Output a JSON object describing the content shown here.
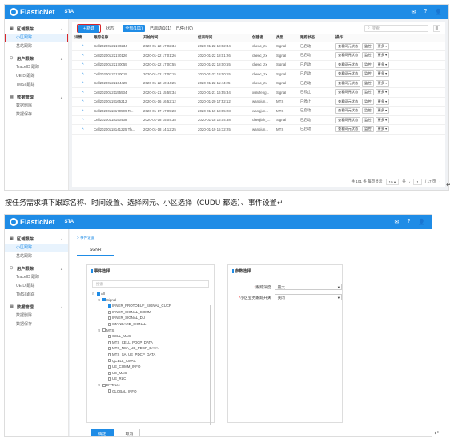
{
  "app": {
    "name": "ElasticNet",
    "product": "STA",
    "top_icons": [
      "mail-icon",
      "help-icon",
      "user-icon"
    ]
  },
  "sidebar": {
    "groups": [
      {
        "label": "区域跟踪",
        "icon": "area-icon",
        "items": [
          {
            "label": "小区跟踪",
            "active": true
          },
          {
            "label": "基站跟踪"
          }
        ]
      },
      {
        "label": "用户跟踪",
        "icon": "user-icon",
        "items": [
          {
            "label": "TraceID 跟踪"
          },
          {
            "label": "UEID 跟踪"
          },
          {
            "label": "TMSI 跟踪"
          }
        ]
      },
      {
        "label": "数据管理",
        "icon": "data-icon",
        "items": [
          {
            "label": "数据删除"
          },
          {
            "label": "数据保存"
          }
        ]
      }
    ]
  },
  "toolbar": {
    "new_label": "+ 新建",
    "status_label": "状态：",
    "tags": [
      "全部(101)",
      "已启动(101)",
      "已停止(0)"
    ],
    "search_placeholder": "搜索"
  },
  "table": {
    "columns": [
      "详情",
      "跟踪名称",
      "开始时间",
      "结束时间",
      "创建者",
      "类型",
      "跟踪状态",
      "操作"
    ],
    "rows": [
      [
        "Cell20200122170234",
        "2020-01-22 17:02:34",
        "2020-01-22 18:02:34",
        "chenc_zx",
        "Signal",
        "已启动"
      ],
      [
        "Cell20200122170126",
        "2020-01-22 17:01:26",
        "2020-01-22 18:01:26",
        "chenc_zx",
        "Signal",
        "已启动"
      ],
      [
        "Cell20200122170055",
        "2020-01-22 17:00:55",
        "2020-01-22 18:00:55",
        "chenc_zx",
        "Signal",
        "已启动"
      ],
      [
        "Cell20200122170015",
        "2020-01-22 17:00:15",
        "2020-01-22 18:00:15",
        "chenc_zx",
        "Signal",
        "已启动"
      ],
      [
        "Cell20200122104425",
        "2020-01-22 10:44:25",
        "2020-01-22 11:44:25",
        "chenc_zx",
        "Signal",
        "已启动"
      ],
      [
        "Cell20200121155534",
        "2020-01-21 15:55:34",
        "2020-01-21 16:55:34",
        "xuliufeng...",
        "Signal",
        "已停止"
      ],
      [
        "Cell20200119165212",
        "2020-01-16 16:52:12",
        "2020-01-20 17:52:12",
        "wangjun...",
        "MTS",
        "已停止"
      ],
      [
        "Cell20200118170509 R...",
        "2020-01-17 17:05:28",
        "2020-01-19 18:05:28",
        "wangjun...",
        "MTS",
        "已启动"
      ],
      [
        "Cell20200118150438",
        "2020-01-18 15:04:38",
        "2020-01-18 16:04:38",
        "chenjiah_...",
        "Signal",
        "已启动"
      ],
      [
        "Cell20200118141225 Th...",
        "2020-01-18 14:12:25",
        "2020-01-19 15:12:25",
        "wangjun...",
        "MTS",
        "已启动"
      ]
    ],
    "actions": [
      "查看网元状态",
      "监控",
      "更多"
    ],
    "expand_symbol": "^"
  },
  "pager": {
    "summary": "共 101 条 每页显示",
    "page_size": "10",
    "unit": "条",
    "page": "1",
    "total": "/ 17 页"
  },
  "caption": "按任务需求填下跟踪名称、时间设置、选择网元、小区选择（CUDU 都选）、事件设置↵",
  "screen2": {
    "crumb": "> 事件设置",
    "tab": "SGNR",
    "left_panel_title": "事件选择",
    "right_panel_title": "参数选择",
    "search_placeholder": "搜索",
    "tree": [
      {
        "label": "All",
        "level": 0,
        "checked": true,
        "tog": "⊟"
      },
      {
        "label": "Signal",
        "level": 1,
        "checked": true,
        "tog": "⊟"
      },
      {
        "label": "INNER_PROTOBUF_SIGNAL_CUCP",
        "level": 2,
        "checked": true
      },
      {
        "label": "INNER_SIGNAL_COMM",
        "level": 2,
        "checked": false
      },
      {
        "label": "INNER_SIGNAL_DU",
        "level": 2,
        "checked": false
      },
      {
        "label": "STANDARD_SIGNAL",
        "level": 2,
        "checked": false
      },
      {
        "label": "MTS",
        "level": 1,
        "checked": false,
        "tog": "⊟"
      },
      {
        "label": "CELL_MAC",
        "level": 2,
        "checked": false
      },
      {
        "label": "MTS_CELL_PDCP_DATA",
        "level": 2,
        "checked": false
      },
      {
        "label": "MTS_NSA_UE_PDCP_DATA",
        "level": 2,
        "checked": false
      },
      {
        "label": "MTS_SA_UE_PDCP_DATA",
        "level": 2,
        "checked": false
      },
      {
        "label": "QCELL_CMAC",
        "level": 2,
        "checked": false
      },
      {
        "label": "UE_COMM_INFO",
        "level": 2,
        "checked": false
      },
      {
        "label": "UE_MAC",
        "level": 2,
        "checked": false
      },
      {
        "label": "UE_RLC",
        "level": 2,
        "checked": false
      },
      {
        "label": "DTTrace",
        "level": 1,
        "checked": false,
        "tog": "⊟"
      },
      {
        "label": "GLOBAL_INFO",
        "level": 2,
        "checked": false
      }
    ],
    "params": [
      {
        "label": "跟踪深度",
        "value": "最大"
      },
      {
        "label": "小区业务跟踪开关",
        "value": "关闭"
      }
    ],
    "ok_label": "确定",
    "cancel_label": "取消"
  },
  "marks": {
    "return": "↵"
  }
}
